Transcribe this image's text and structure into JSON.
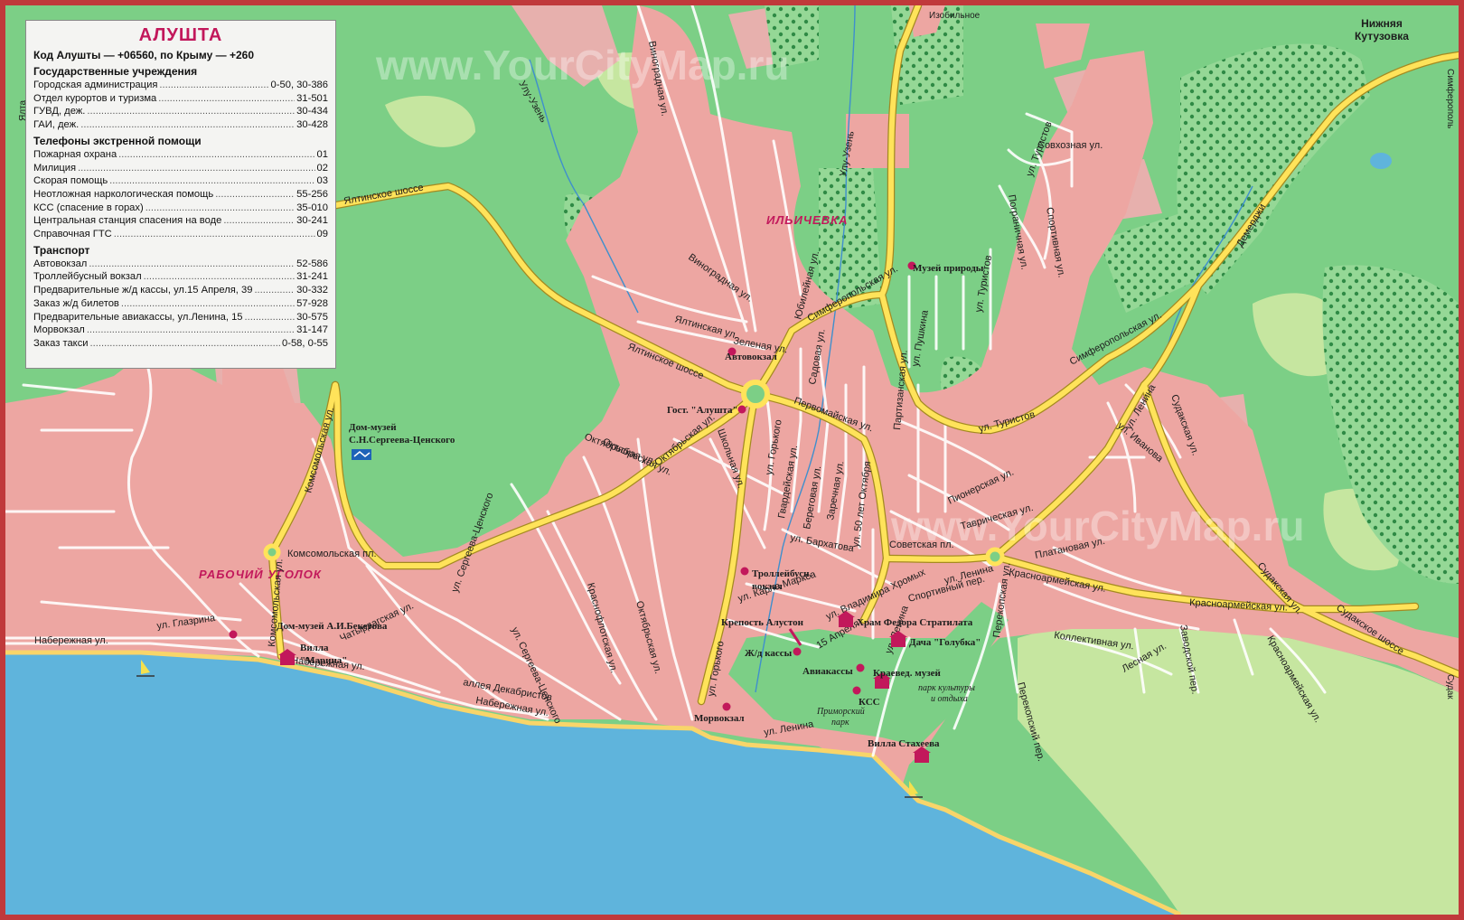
{
  "watermark": "www.YourCityMap.ru",
  "colors": {
    "sea": "#5fb4dc",
    "land": "#7ccf86",
    "town": "#eda6a2",
    "road_major": "#ffe35a",
    "poi": "#c2185b",
    "frame": "#c0393b"
  },
  "legend": {
    "title": "АЛУШТА",
    "codes": "Код Алушты — +06560, по Крыму — +260",
    "sections": [
      {
        "name": "Государственные учреждения",
        "rows": [
          {
            "name": "Городская администрация",
            "phone": "0-50, 30-386"
          },
          {
            "name": "Отдел курортов и туризма",
            "phone": "31-501"
          },
          {
            "name": "ГУВД, деж.",
            "phone": "30-434"
          },
          {
            "name": "ГАИ, деж.",
            "phone": "30-428"
          }
        ]
      },
      {
        "name": "Телефоны экстренной помощи",
        "rows": [
          {
            "name": "Пожарная охрана",
            "phone": "01"
          },
          {
            "name": "Милиция",
            "phone": "02"
          },
          {
            "name": "Скорая помощь",
            "phone": "03"
          },
          {
            "name": "Неотложная наркологическая помощь",
            "phone": "55-256"
          },
          {
            "name": "КСС (спасение в горах)",
            "phone": "35-010"
          },
          {
            "name": "Центральная станция спасения на воде",
            "phone": "30-241"
          },
          {
            "name": "Справочная ГТС",
            "phone": "09"
          }
        ]
      },
      {
        "name": "Транспорт",
        "rows": [
          {
            "name": "Автовокзал",
            "phone": "52-586"
          },
          {
            "name": "Троллейбусный вокзал",
            "phone": "31-241"
          },
          {
            "name": "Предварительные ж/д кассы, ул.15 Апреля, 39",
            "phone": "30-332"
          },
          {
            "name": "Заказ ж/д билетов",
            "phone": "57-928"
          },
          {
            "name": "Предварительные авиакассы, ул.Ленина, 15",
            "phone": "30-575"
          },
          {
            "name": "Морвокзал",
            "phone": "31-147"
          },
          {
            "name": "Заказ такси",
            "phone": "0-58, 0-55"
          }
        ]
      }
    ]
  },
  "places": {
    "nizhnyaya_1": "Нижняя",
    "nizhnyaya_2": "Кутузовка",
    "izobilnoe": "Изобильное",
    "ilichevka": "ИЛЬИЧЕВКА",
    "rabochiy": "РАБОЧИЙ УГОЛОК",
    "yalta": "Ялта",
    "simferopol": "Симферополь",
    "sudak": "Судак"
  },
  "streets": {
    "yaltinskoe_n": "Ялтинское шоссе",
    "yaltinskoe_s": "Ялтинское шоссе",
    "simfer_1": "Симферопольская ул.",
    "simfer_2": "Симферопольская ул.",
    "vinogradnaya_1": "Виноградная ул.",
    "vinogradnaya_2": "Виноградная ул.",
    "ulu_uzen_1": "Улу-Узень",
    "ulu_uzen_2": "Улу-Узень",
    "sovhoznaya": "Совхозная ул.",
    "turistov_1": "ул. Туристов",
    "turistov_2": "ул. Туристов",
    "turistov_3": "ул. Туристов",
    "sportivnaya_n": "Спортивная ул.",
    "pogranichnaya_n": "Пограничная ул.",
    "demerdzhi": "Демерджи",
    "zelenaya": "Зеленая ул.",
    "yaltinskaya": "Ялтинская ул.",
    "yubileynaya": "Юбилейная ул.",
    "pushkina": "ул. Пушкина",
    "gorkogo_1": "ул. Горького",
    "gorkogo_2": "ул. Горького",
    "partizanskaya": "Партизанская ул.",
    "lenina_1": "ул. Ленина",
    "lenina_2": "ул. Ленина",
    "lenina_3": "ул. Ленина",
    "lenina_4": "ул. Ленина",
    "ivanova": "ул. Иванова",
    "sudakskaya": "Судакская ул.",
    "sudakskaya_2": "Судакская ул.",
    "sudakskoe": "Судакское шоссе",
    "krasnoarm_1": "Красноармейская ул.",
    "krasnoarm_2": "Красноармейская ул.",
    "krasnoarm_3": "Красноармейская ул.",
    "oktyabrskaya_1": "Октябрьская ул.",
    "oktyabrskaya_2": "Октябрьская ул.",
    "oktyabrskaya_3": "Октябрьская ул.",
    "shkolnaya": "Школьная ул.",
    "sadovaya": "Садовая ул.",
    "pervomayskaya": "Первомайская ул.",
    "gvardeyskaya": "Гвардейская ул.",
    "beregovaya": "Береговая ул.",
    "zarechnaya": "Заречная ул.",
    "ul50let": "ул. 50 лет Октября",
    "barhatova": "ул. Бархатова",
    "karla_marksa": "ул. Карла Маркса",
    "vl_hromyh": "ул. Владимира Хромых",
    "aprelya": "15 Апреля",
    "pionerskaya": "Пионерская ул.",
    "tavricheskaya": "Таврическая ул.",
    "sportivny_per": "Спортивный пер.",
    "platanovaya": "Платановая ул.",
    "kollektivnaya": "Коллективная ул.",
    "lesnaya": "Лесная ул.",
    "zavodskoy": "Заводской пер.",
    "perekopskaya": "Перекопская ул.",
    "perekopsky": "Перекопский пер.",
    "komsomolskaya_1": "Комсомольская ул.",
    "komsomolskaya_2": "Комсомольская ул.",
    "sergeeva_1": "ул. Сергеева-Ценского",
    "sergeeva_2": "ул. Сергеева-Ценского",
    "glazrina": "ул. Глазрина",
    "naberezhnaya_1": "Набережная ул.",
    "naberezhnaya_2": "Набережная ул.",
    "naberezhnaya_3": "Набережная ул.",
    "dekabristov": "аллея Декабристов",
    "chatyrdag": "Чатырдагская ул.",
    "krasnoflotskaya": "Краснофлотская ул.",
    "komsomolskaya_pl": "Комсомольская пл.",
    "sovetskaya_pl": "Советская пл.",
    "oktyabr_top": "Октябрьская ул."
  },
  "pois": {
    "muzey_prirody": "Музей природы",
    "avtovokzal": "Автовокзал",
    "gost_alushta": "Гост. \"Алушта\"",
    "dom_sergeeva_1": "Дом-музей",
    "dom_sergeeva_2": "С.Н.Сергеева-Ценского",
    "trolley_1": "Троллейбусн.",
    "trolley_2": "вокзал",
    "krepost": "Крепость Алустон",
    "hram": "Храм Федора Стратилата",
    "dacha": "Дача \"Голубка\"",
    "zhd_kassy": "Ж/д кассы",
    "aviakassy": "Авиакассы",
    "kraeved": "Краевед. музей",
    "kss": "КСС",
    "park_1": "парк культуры",
    "park_2": "и отдыха",
    "primorsky_1": "Приморский",
    "primorsky_2": "парк",
    "morvokzal": "Морвокзал",
    "villa_stahe": "Вилла Стахеева",
    "dom_beketova": "Дом-музей А.И.Бекетова",
    "villa_marina_1": "Вилла",
    "villa_marina_2": "\"Марина\""
  }
}
